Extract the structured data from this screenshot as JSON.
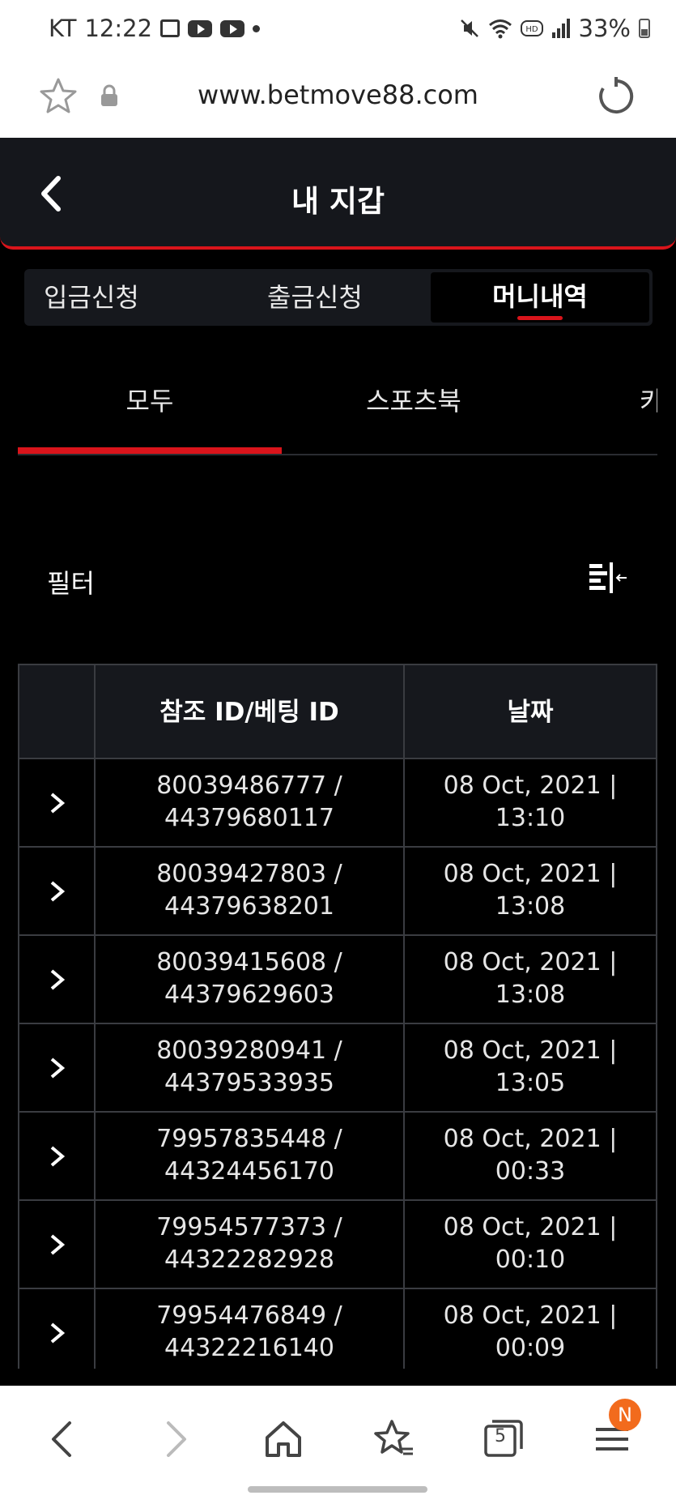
{
  "status_bar": {
    "carrier": "KT",
    "time": "12:22",
    "battery": "33%",
    "icons": [
      "gallery-icon",
      "youtube-icon",
      "youtube-icon",
      "dot-icon",
      "mute-icon",
      "wifi-icon",
      "hd-icon",
      "signal-icon",
      "battery-icon"
    ]
  },
  "browser": {
    "url": "www.betmove88.com",
    "tab_count": "5",
    "menu_badge": "N"
  },
  "header": {
    "title": "내 지갑"
  },
  "main_tabs": [
    {
      "label": "입금신청",
      "active": false
    },
    {
      "label": "출금신청",
      "active": false
    },
    {
      "label": "머니내역",
      "active": true
    }
  ],
  "sub_tabs": [
    {
      "label": "모두",
      "active": true
    },
    {
      "label": "스포츠북",
      "active": false
    },
    {
      "label": "카",
      "active": false
    }
  ],
  "filter": {
    "label": "필터"
  },
  "table": {
    "columns": [
      "",
      "참조 ID/베팅 ID",
      "날짜"
    ],
    "rows": [
      {
        "ref": "80039486777 /",
        "bet": "44379680117",
        "date": "08 Oct, 2021 |",
        "time": "13:10"
      },
      {
        "ref": "80039427803 /",
        "bet": "44379638201",
        "date": "08 Oct, 2021 |",
        "time": "13:08"
      },
      {
        "ref": "80039415608 /",
        "bet": "44379629603",
        "date": "08 Oct, 2021 |",
        "time": "13:08"
      },
      {
        "ref": "80039280941 /",
        "bet": "44379533935",
        "date": "08 Oct, 2021 |",
        "time": "13:05"
      },
      {
        "ref": "79957835448 /",
        "bet": "44324456170",
        "date": "08 Oct, 2021 |",
        "time": "00:33"
      },
      {
        "ref": "79954577373 /",
        "bet": "44322282928",
        "date": "08 Oct, 2021 |",
        "time": "00:10"
      },
      {
        "ref": "79954476849 /",
        "bet": "44322216140",
        "date": "08 Oct, 2021 |",
        "time": "00:09"
      }
    ]
  },
  "colors": {
    "accent": "#d9141b",
    "background": "#000000",
    "header_bg": "#15171c",
    "badge": "#f26b1d"
  }
}
